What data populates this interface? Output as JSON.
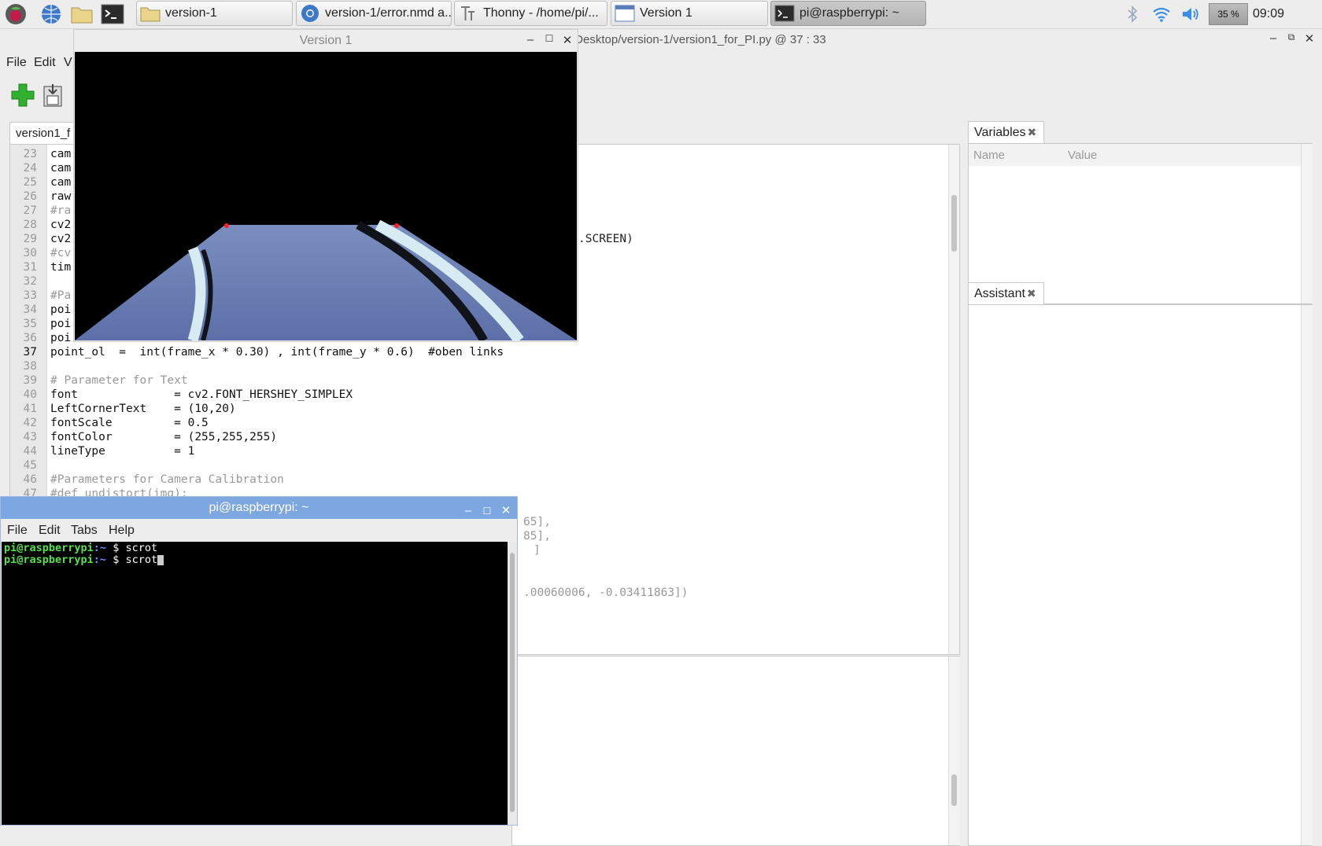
{
  "taskbar": {
    "tasks": [
      {
        "label": "version-1",
        "icon": "folder-icon"
      },
      {
        "label": "version-1/error.nmd a...",
        "icon": "chromium-icon"
      },
      {
        "label": "Thonny  -  /home/pi/...",
        "icon": "thonny-icon"
      },
      {
        "label": "Version 1",
        "icon": "window-icon"
      },
      {
        "label": "pi@raspberrypi: ~",
        "icon": "terminal-icon"
      }
    ],
    "battery": "35 %",
    "clock": "09:09"
  },
  "thonny": {
    "title_path": "/Desktop/version-1/version1_for_PI.py  @  37 : 33",
    "menu": [
      "File",
      "Edit",
      "V"
    ],
    "editor_tab": "version1_f",
    "code_lines": [
      {
        "n": "23",
        "t": "cam"
      },
      {
        "n": "24",
        "t": "cam"
      },
      {
        "n": "25",
        "t": "cam"
      },
      {
        "n": "26",
        "t": "raw"
      },
      {
        "n": "27",
        "t": "#ra"
      },
      {
        "n": "28",
        "t": "cv2"
      },
      {
        "n": "29",
        "t": "cv2"
      },
      {
        "n": "30",
        "t": "#cv"
      },
      {
        "n": "31",
        "t": "tim"
      },
      {
        "n": "32",
        "t": ""
      },
      {
        "n": "33",
        "t": "#Pa"
      },
      {
        "n": "34",
        "t": "poi"
      },
      {
        "n": "35",
        "t": "poi"
      },
      {
        "n": "36",
        "t": "poi"
      },
      {
        "n": "37",
        "t": "point_ol  =  int(frame_x * 0.30) , int(frame_y * 0.6)  #oben links"
      },
      {
        "n": "38",
        "t": ""
      },
      {
        "n": "39",
        "t": "# Parameter for Text"
      },
      {
        "n": "40",
        "t": "font              = cv2.FONT_HERSHEY_SIMPLEX"
      },
      {
        "n": "41",
        "t": "LeftCornerText    = (10,20)"
      },
      {
        "n": "42",
        "t": "fontScale         = 0.5"
      },
      {
        "n": "43",
        "t": "fontColor         = (255,255,255)"
      },
      {
        "n": "44",
        "t": "lineType          = 1"
      },
      {
        "n": "45",
        "t": ""
      },
      {
        "n": "46",
        "t": "#Parameters for Camera Calibration"
      },
      {
        "n": "47",
        "t": "#def undistort(img):"
      }
    ],
    "code_fragments": [
      ".SCREEN)",
      "65],",
      "85],",
      "]",
      ".00060006, -0.03411863])"
    ],
    "variables_tab": "Variables",
    "var_cols": [
      "Name",
      "Value"
    ],
    "assistant_tab": "Assistant"
  },
  "image_window": {
    "title": "Version 1"
  },
  "terminal": {
    "title": "pi@raspberrypi: ~",
    "menu": [
      "File",
      "Edit",
      "Tabs",
      "Help"
    ],
    "user": "pi@raspberrypi",
    "path": ":~",
    "lines": [
      "$ scrot",
      "$ scrot"
    ]
  }
}
